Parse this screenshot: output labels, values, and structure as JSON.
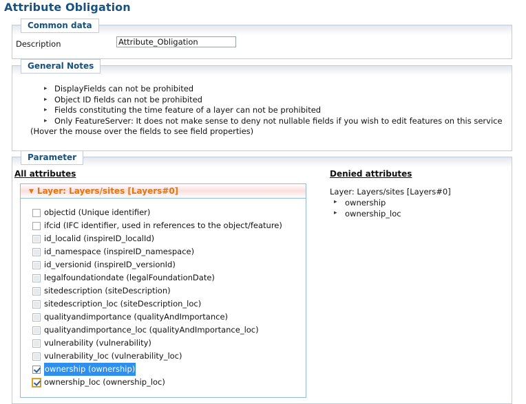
{
  "page": {
    "title": "Attribute Obligation",
    "title_color": "#18527f"
  },
  "common_data": {
    "legend": "Common data",
    "description_label": "Description",
    "description_value": "Attribute_Obligation",
    "description_placeholder": ""
  },
  "general_notes": {
    "legend": "General Notes",
    "bullet_glyph": "▸",
    "notes": [
      "DisplayFields can not be prohibited",
      "Object ID fields can not be prohibited",
      "Fields constituting the time feature of a layer can not be prohibited",
      "Only FeatureServer: It does not make sense to deny not nullable fields if you wish to edit features on this service"
    ],
    "hover_hint": "(Hover the mouse over the fields to see field properties)"
  },
  "parameter": {
    "legend": "Parameter",
    "all_attributes_heading": "All attributes",
    "denied_attributes_heading": "Denied attributes",
    "layer": {
      "header": "Layer: Layers/sites [Layers#0]",
      "collapse_glyph": "▼",
      "header_color": "#e8740c"
    },
    "attributes": [
      {
        "label": "objectid (Unique identifier)",
        "state": "unchecked",
        "selected": false,
        "focused": false
      },
      {
        "label": "ifcid (IFC identifier, used in references to the object/feature)",
        "state": "unchecked",
        "selected": false,
        "focused": false
      },
      {
        "label": "id_localid (inspireID_localId)",
        "state": "disabled",
        "selected": false,
        "focused": false
      },
      {
        "label": "id_namespace (inspireID_namespace)",
        "state": "disabled",
        "selected": false,
        "focused": false
      },
      {
        "label": "id_versionid (inspireID_versionId)",
        "state": "disabled",
        "selected": false,
        "focused": false
      },
      {
        "label": "legalfoundationdate (legalFoundationDate)",
        "state": "disabled",
        "selected": false,
        "focused": false
      },
      {
        "label": "sitedescription (siteDescription)",
        "state": "disabled",
        "selected": false,
        "focused": false
      },
      {
        "label": "sitedescription_loc (siteDescription_loc)",
        "state": "disabled",
        "selected": false,
        "focused": false
      },
      {
        "label": "qualityandimportance (qualityAndImportance)",
        "state": "disabled",
        "selected": false,
        "focused": false
      },
      {
        "label": "qualityandimportance_loc (qualityAndImportance_loc)",
        "state": "disabled",
        "selected": false,
        "focused": false
      },
      {
        "label": "vulnerability (vulnerability)",
        "state": "disabled",
        "selected": false,
        "focused": false
      },
      {
        "label": "vulnerability_loc (vulnerability_loc)",
        "state": "disabled",
        "selected": false,
        "focused": false
      },
      {
        "label": "ownership (ownership)",
        "state": "checked",
        "selected": true,
        "focused": false
      },
      {
        "label": "ownership_loc (ownership_loc)",
        "state": "checked",
        "selected": false,
        "focused": true
      }
    ],
    "denied": {
      "layer_label": "Layer: Layers/sites [Layers#0]",
      "bullet_glyph": "▸",
      "items": [
        "ownership",
        "ownership_loc"
      ]
    }
  },
  "colors": {
    "selection_blue": "#2f8fee",
    "focus_gold": "#e0a524",
    "panel_border": "#8fb9dd",
    "fieldset_border": "#c3cbd6",
    "legend_text": "#17527e"
  }
}
